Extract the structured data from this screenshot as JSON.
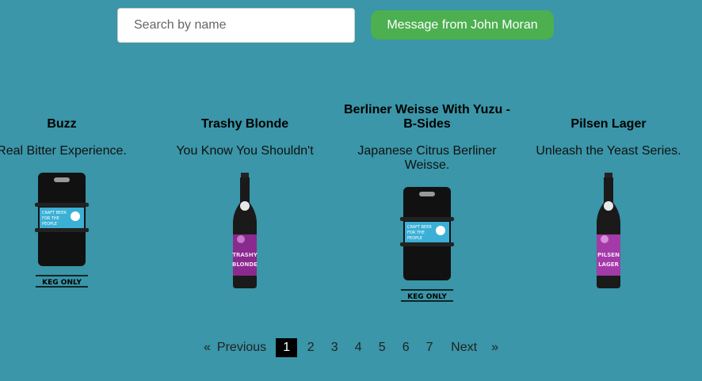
{
  "search": {
    "placeholder": "Search by name",
    "value": ""
  },
  "message_button": {
    "label": "Message from John Moran"
  },
  "beers": [
    {
      "name": "Buzz",
      "tagline": "Real Bitter Experience.",
      "image": "keg-icon"
    },
    {
      "name": "Trashy Blonde",
      "tagline": "You Know You Shouldn't",
      "image": "bottle-trashy-blonde"
    },
    {
      "name": "Berliner Weisse With Yuzu - B-Sides",
      "tagline": "Japanese Citrus Berliner Weisse.",
      "image": "keg-icon"
    },
    {
      "name": "Pilsen Lager",
      "tagline": "Unleash the Yeast Series.",
      "image": "bottle-pilsen-lager"
    }
  ],
  "keg": {
    "label_line1": "CRAFT BEER",
    "label_line2": "FOR THE",
    "label_line3": "PEOPLE",
    "footer": "KEG ONLY"
  },
  "bottles": {
    "trashy": [
      "TRASHY",
      "BLONDE"
    ],
    "pilsen": [
      "PILSEN",
      "LAGER"
    ]
  },
  "pagination": {
    "first": "«",
    "previous": "Previous",
    "pages": [
      "1",
      "2",
      "3",
      "4",
      "5",
      "6",
      "7"
    ],
    "current": "1",
    "next": "Next",
    "last": "»"
  },
  "colors": {
    "background": "#3a96a8",
    "button": "#4caf50",
    "active_page": "#000000"
  }
}
